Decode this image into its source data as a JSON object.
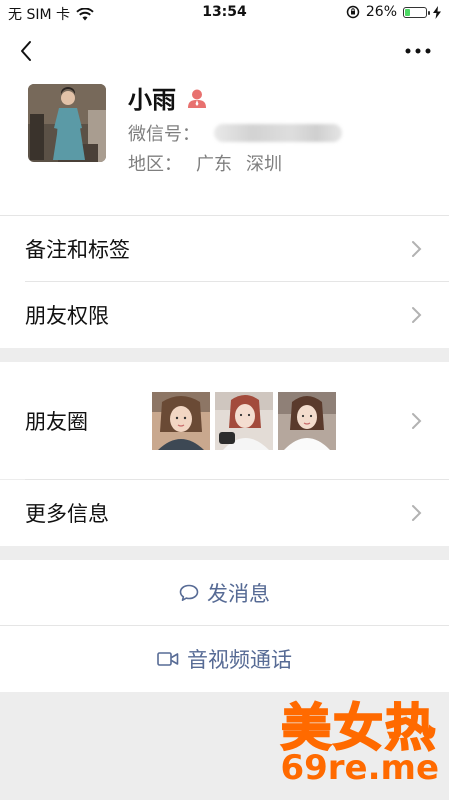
{
  "status_bar": {
    "carrier": "无 SIM 卡",
    "time": "13:54",
    "battery": "26%",
    "battery_level": 0.26
  },
  "profile": {
    "name": "小雨",
    "wechat_id_label": "微信号：",
    "region_label": "地区：",
    "region_province": "广东",
    "region_city": "深圳"
  },
  "menu": {
    "remarks": "备注和标签",
    "permissions": "朋友权限",
    "moments": "朋友圈",
    "more_info": "更多信息"
  },
  "actions": {
    "message": "发消息",
    "call": "音视频通话"
  },
  "colors": {
    "link": "#576b95",
    "gender": "#e8716f",
    "watermark": "#ff6a00"
  },
  "watermark": {
    "line1": "美女热",
    "line2": "69re.me"
  }
}
